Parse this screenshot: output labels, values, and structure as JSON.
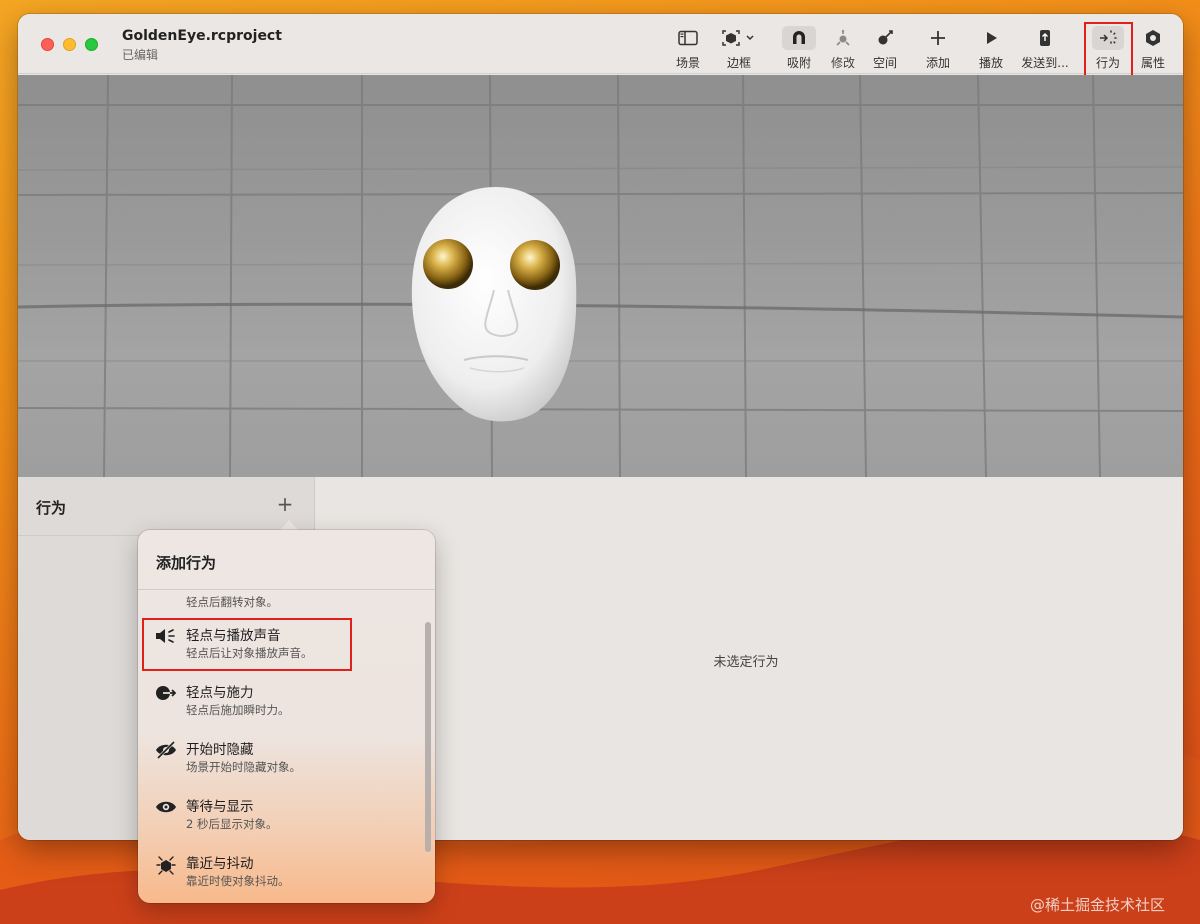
{
  "window": {
    "project_title": "GoldenEye.rcproject",
    "project_status": "已编辑"
  },
  "toolbar": {
    "items": [
      {
        "label": "场景",
        "icon": "sidebar-icon"
      },
      {
        "label": "边框",
        "icon": "bounding-box-icon"
      },
      {
        "label": "吸附",
        "icon": "magnet-icon"
      },
      {
        "label": "修改",
        "icon": "modify-icon"
      },
      {
        "label": "空间",
        "icon": "space-icon"
      },
      {
        "label": "添加",
        "icon": "plus-icon"
      },
      {
        "label": "播放",
        "icon": "play-icon"
      },
      {
        "label": "发送到...",
        "icon": "send-to-device-icon"
      },
      {
        "label": "行为",
        "icon": "behaviors-icon"
      },
      {
        "label": "属性",
        "icon": "properties-icon"
      }
    ]
  },
  "behaviors_panel": {
    "title": "行为",
    "add_symbol": "+",
    "empty_message": "未选定行为"
  },
  "add_behavior_popover": {
    "title": "添加行为",
    "partial_item_desc": "轻点后翻转对象。",
    "items": [
      {
        "name": "轻点与播放声音",
        "desc": "轻点后让对象播放声音。",
        "icon": "speaker-icon"
      },
      {
        "name": "轻点与施力",
        "desc": "轻点后施加瞬时力。",
        "icon": "apply-force-icon"
      },
      {
        "name": "开始时隐藏",
        "desc": "场景开始时隐藏对象。",
        "icon": "eye-slash-icon"
      },
      {
        "name": "等待与显示",
        "desc": "2 秒后显示对象。",
        "icon": "eye-icon"
      },
      {
        "name": "靠近与抖动",
        "desc": "靠近时使对象抖动。",
        "icon": "proximity-shake-icon"
      }
    ]
  },
  "watermark": "@稀土掘金技术社区",
  "colors": {
    "highlight_red": "#e0201b",
    "gold": "#c9a23a"
  }
}
